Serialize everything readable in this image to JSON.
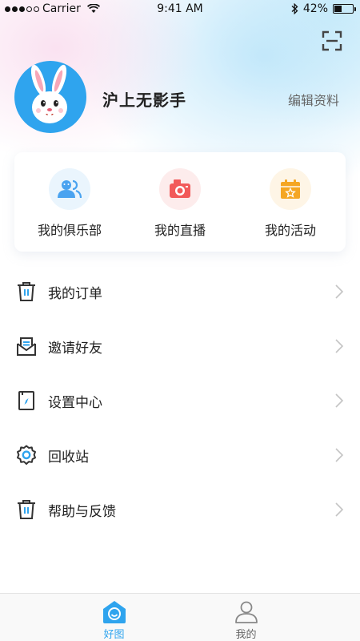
{
  "status_bar": {
    "carrier": "Carrier",
    "time": "9:41 AM",
    "battery_percent": "42%",
    "battery_level": 0.42
  },
  "header": {
    "scan_icon": "scan-icon"
  },
  "profile": {
    "avatar": "rabbit-avatar",
    "username": "沪上无影手",
    "edit_label": "编辑资料"
  },
  "quick_actions": [
    {
      "label": "我的俱乐部",
      "icon": "people-icon",
      "color": "#4aa3f0",
      "bg": "#eaf5fd"
    },
    {
      "label": "我的直播",
      "icon": "camera-icon",
      "color": "#f25a5a",
      "bg": "#fdecec"
    },
    {
      "label": "我的活动",
      "icon": "calendar-star-icon",
      "color": "#f5a623",
      "bg": "#fef5e6"
    }
  ],
  "menu": [
    {
      "label": "我的订单",
      "icon": "trash-icon"
    },
    {
      "label": "邀请好友",
      "icon": "mail-icon"
    },
    {
      "label": "设置中心",
      "icon": "compass-book-icon"
    },
    {
      "label": "回收站",
      "icon": "gear-icon"
    },
    {
      "label": "帮助与反馈",
      "icon": "trash-icon"
    }
  ],
  "tabs": [
    {
      "label": "好图",
      "icon": "home-smile-icon",
      "active": true
    },
    {
      "label": "我的",
      "icon": "user-icon",
      "active": false
    }
  ],
  "colors": {
    "accent": "#2fa4ee",
    "text": "#222222",
    "muted": "#666666"
  }
}
